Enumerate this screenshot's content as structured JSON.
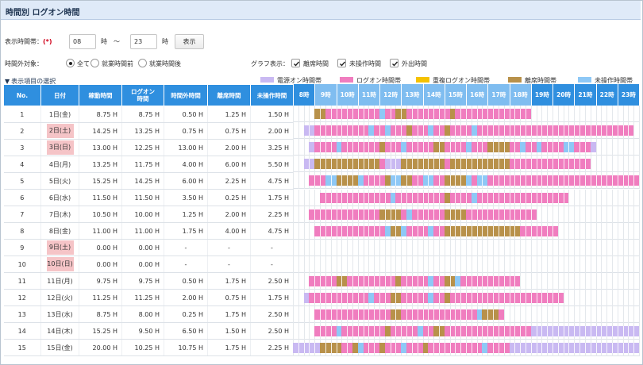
{
  "page": {
    "title": "時間別 ログオン時間"
  },
  "filter": {
    "range_label": "表示時間帯：",
    "required_mark": "(*)",
    "from_value": "08",
    "from_unit": "時",
    "tilde": "～",
    "to_value": "23",
    "to_unit": "時",
    "show_button": "表示"
  },
  "outside": {
    "label": "時間外対象：",
    "options": [
      {
        "label": "全て",
        "selected": true
      },
      {
        "label": "就業時間前",
        "selected": false
      },
      {
        "label": "就業時間後",
        "selected": false
      }
    ]
  },
  "graph": {
    "label": "グラフ表示：",
    "options": [
      {
        "label": "離席時間",
        "checked": true
      },
      {
        "label": "未操作時間",
        "checked": true
      },
      {
        "label": "外出時間",
        "checked": true
      }
    ]
  },
  "select_items_link": "表示項目の選択",
  "colors": {
    "power": "#c9b9f2",
    "logon": "#f07dbf",
    "dup": "#f5c200",
    "away": "#b8914a",
    "idle": "#8ec8f6",
    "header": "#2f8fdf",
    "header_band": "#7fbdf0",
    "holiday": "#f5c4c7"
  },
  "legend": [
    {
      "key": "power",
      "label": "電源オン時間帯"
    },
    {
      "key": "logon",
      "label": "ログオン時間帯"
    },
    {
      "key": "dup",
      "label": "重複ログオン時間帯"
    },
    {
      "key": "away",
      "label": "離席時間帯"
    },
    {
      "key": "idle",
      "label": "未操作時間帯"
    }
  ],
  "columns": [
    "No.",
    "日付",
    "稼動時間",
    "ログオン\n時間",
    "時間外時間",
    "離席時間",
    "未操作時間"
  ],
  "hours": [
    "8時",
    "9時",
    "10時",
    "11時",
    "12時",
    "13時",
    "14時",
    "15時",
    "16時",
    "17時",
    "18時",
    "19時",
    "20時",
    "21時",
    "22時",
    "23時"
  ],
  "rows": [
    {
      "no": "1",
      "date": "1日(金)",
      "holiday": false,
      "work": "8.75 H",
      "logon": "8.75 H",
      "outside": "0.50 H",
      "away": "1.25 H",
      "idle": "1.50 H",
      "segments": [
        [
          "away",
          9.0,
          9.5
        ],
        [
          "logon",
          9.5,
          12.0
        ],
        [
          "idle",
          12.0,
          12.25
        ],
        [
          "logon",
          12.25,
          12.75
        ],
        [
          "away",
          12.75,
          13.25
        ],
        [
          "logon",
          13.25,
          15.25
        ],
        [
          "away",
          15.25,
          15.5
        ],
        [
          "logon",
          15.5,
          19.0
        ]
      ]
    },
    {
      "no": "2",
      "date": "2日(土)",
      "holiday": true,
      "work": "14.25 H",
      "logon": "13.25 H",
      "outside": "0.75 H",
      "away": "0.75 H",
      "idle": "2.00 H",
      "segments": [
        [
          "power",
          8.5,
          9.0
        ],
        [
          "logon",
          9.0,
          11.5
        ],
        [
          "idle",
          11.5,
          11.75
        ],
        [
          "logon",
          11.75,
          12.25
        ],
        [
          "idle",
          12.25,
          12.5
        ],
        [
          "logon",
          12.5,
          13.25
        ],
        [
          "away",
          13.25,
          13.5
        ],
        [
          "logon",
          13.5,
          14.25
        ],
        [
          "idle",
          14.25,
          14.5
        ],
        [
          "logon",
          14.5,
          15.0
        ],
        [
          "away",
          15.0,
          15.25
        ],
        [
          "logon",
          15.25,
          16.25
        ],
        [
          "idle",
          16.25,
          16.5
        ],
        [
          "logon",
          16.5,
          23.75
        ]
      ]
    },
    {
      "no": "3",
      "date": "3日(日)",
      "holiday": true,
      "work": "13.00 H",
      "logon": "12.25 H",
      "outside": "13.00 H",
      "away": "2.00 H",
      "idle": "3.25 H",
      "segments": [
        [
          "power",
          8.75,
          9.0
        ],
        [
          "logon",
          9.0,
          10.0
        ],
        [
          "idle",
          10.0,
          10.25
        ],
        [
          "logon",
          10.25,
          12.0
        ],
        [
          "away",
          12.0,
          12.25
        ],
        [
          "logon",
          12.25,
          13.0
        ],
        [
          "idle",
          13.0,
          13.25
        ],
        [
          "logon",
          13.25,
          14.5
        ],
        [
          "away",
          14.5,
          15.0
        ],
        [
          "logon",
          15.0,
          16.0
        ],
        [
          "idle",
          16.0,
          16.25
        ],
        [
          "logon",
          16.25,
          17.0
        ],
        [
          "away",
          17.0,
          18.0
        ],
        [
          "logon",
          18.0,
          18.5
        ],
        [
          "idle",
          18.5,
          18.75
        ],
        [
          "logon",
          18.75,
          19.25
        ],
        [
          "idle",
          19.25,
          19.5
        ],
        [
          "logon",
          19.5,
          20.5
        ],
        [
          "idle",
          20.5,
          21.0
        ],
        [
          "logon",
          21.0,
          21.75
        ],
        [
          "power",
          21.75,
          22.0
        ]
      ]
    },
    {
      "no": "4",
      "date": "4日(月)",
      "holiday": false,
      "work": "13.25 H",
      "logon": "11.75 H",
      "outside": "4.00 H",
      "away": "6.00 H",
      "idle": "5.50 H",
      "segments": [
        [
          "power",
          8.5,
          9.0
        ],
        [
          "away",
          9.0,
          12.0
        ],
        [
          "logon",
          12.0,
          12.25
        ],
        [
          "power",
          12.25,
          13.0
        ],
        [
          "away",
          13.0,
          15.0
        ],
        [
          "logon",
          15.0,
          15.25
        ],
        [
          "away",
          15.25,
          18.0
        ],
        [
          "logon",
          18.0,
          21.75
        ]
      ]
    },
    {
      "no": "5",
      "date": "5日(火)",
      "holiday": false,
      "work": "15.25 H",
      "logon": "14.25 H",
      "outside": "6.00 H",
      "away": "2.25 H",
      "idle": "4.75 H",
      "segments": [
        [
          "logon",
          8.75,
          9.5
        ],
        [
          "idle",
          9.5,
          10.0
        ],
        [
          "away",
          10.0,
          11.0
        ],
        [
          "idle",
          11.0,
          11.25
        ],
        [
          "logon",
          11.25,
          12.25
        ],
        [
          "away",
          12.25,
          12.5
        ],
        [
          "idle",
          12.5,
          13.0
        ],
        [
          "away",
          13.0,
          13.5
        ],
        [
          "logon",
          13.5,
          14.0
        ],
        [
          "idle",
          14.0,
          14.5
        ],
        [
          "logon",
          14.5,
          15.0
        ],
        [
          "away",
          15.0,
          16.0
        ],
        [
          "idle",
          16.0,
          16.25
        ],
        [
          "logon",
          16.25,
          16.5
        ],
        [
          "idle",
          16.5,
          17.0
        ],
        [
          "logon",
          17.0,
          24.0
        ]
      ]
    },
    {
      "no": "6",
      "date": "6日(水)",
      "holiday": false,
      "work": "11.50 H",
      "logon": "11.50 H",
      "outside": "3.50 H",
      "away": "0.25 H",
      "idle": "1.75 H",
      "segments": [
        [
          "logon",
          9.25,
          12.5
        ],
        [
          "idle",
          12.5,
          12.75
        ],
        [
          "logon",
          12.75,
          15.0
        ],
        [
          "away",
          15.0,
          15.25
        ],
        [
          "logon",
          15.25,
          16.25
        ],
        [
          "idle",
          16.25,
          16.5
        ],
        [
          "logon",
          16.5,
          20.75
        ]
      ]
    },
    {
      "no": "7",
      "date": "7日(木)",
      "holiday": false,
      "work": "10.50 H",
      "logon": "10.00 H",
      "outside": "1.25 H",
      "away": "2.00 H",
      "idle": "2.25 H",
      "segments": [
        [
          "logon",
          8.75,
          12.0
        ],
        [
          "away",
          12.0,
          13.0
        ],
        [
          "logon",
          13.0,
          13.25
        ],
        [
          "idle",
          13.25,
          13.5
        ],
        [
          "logon",
          13.5,
          15.0
        ],
        [
          "away",
          15.0,
          16.0
        ],
        [
          "logon",
          16.0,
          19.25
        ]
      ]
    },
    {
      "no": "8",
      "date": "8日(金)",
      "holiday": false,
      "work": "11.00 H",
      "logon": "11.00 H",
      "outside": "1.75 H",
      "away": "4.00 H",
      "idle": "4.75 H",
      "segments": [
        [
          "logon",
          9.0,
          12.25
        ],
        [
          "idle",
          12.25,
          12.5
        ],
        [
          "away",
          12.5,
          13.0
        ],
        [
          "idle",
          13.0,
          13.25
        ],
        [
          "logon",
          13.25,
          14.25
        ],
        [
          "idle",
          14.25,
          14.5
        ],
        [
          "logon",
          14.5,
          15.0
        ],
        [
          "away",
          15.0,
          18.5
        ],
        [
          "logon",
          18.5,
          20.25
        ]
      ]
    },
    {
      "no": "9",
      "date": "9日(土)",
      "holiday": true,
      "work": "0.00 H",
      "logon": "0.00 H",
      "outside": "-",
      "away": "-",
      "idle": "-",
      "segments": []
    },
    {
      "no": "10",
      "date": "10日(日)",
      "holiday": true,
      "work": "0.00 H",
      "logon": "0.00 H",
      "outside": "-",
      "away": "-",
      "idle": "-",
      "segments": []
    },
    {
      "no": "11",
      "date": "11日(月)",
      "holiday": false,
      "work": "9.75 H",
      "logon": "9.75 H",
      "outside": "0.50 H",
      "away": "1.75 H",
      "idle": "2.50 H",
      "segments": [
        [
          "logon",
          8.75,
          10.0
        ],
        [
          "away",
          10.0,
          10.5
        ],
        [
          "logon",
          10.5,
          12.75
        ],
        [
          "away",
          12.75,
          13.0
        ],
        [
          "logon",
          13.0,
          14.25
        ],
        [
          "idle",
          14.25,
          14.5
        ],
        [
          "logon",
          14.5,
          15.0
        ],
        [
          "away",
          15.0,
          15.5
        ],
        [
          "idle",
          15.5,
          15.75
        ],
        [
          "logon",
          15.75,
          18.5
        ]
      ]
    },
    {
      "no": "12",
      "date": "12日(火)",
      "holiday": false,
      "work": "11.25 H",
      "logon": "11.25 H",
      "outside": "2.00 H",
      "away": "0.75 H",
      "idle": "1.75 H",
      "segments": [
        [
          "power",
          8.5,
          8.75
        ],
        [
          "logon",
          8.75,
          11.5
        ],
        [
          "idle",
          11.5,
          11.75
        ],
        [
          "logon",
          11.75,
          12.5
        ],
        [
          "away",
          12.5,
          13.0
        ],
        [
          "logon",
          13.0,
          14.25
        ],
        [
          "idle",
          14.25,
          14.5
        ],
        [
          "logon",
          14.5,
          15.0
        ],
        [
          "away",
          15.0,
          15.25
        ],
        [
          "logon",
          15.25,
          20.5
        ]
      ]
    },
    {
      "no": "13",
      "date": "13日(水)",
      "holiday": false,
      "work": "8.75 H",
      "logon": "8.00 H",
      "outside": "0.25 H",
      "away": "1.75 H",
      "idle": "2.50 H",
      "segments": [
        [
          "logon",
          9.0,
          12.5
        ],
        [
          "away",
          12.5,
          13.0
        ],
        [
          "logon",
          13.0,
          16.5
        ],
        [
          "idle",
          16.5,
          16.75
        ],
        [
          "away",
          16.75,
          17.5
        ],
        [
          "logon",
          17.5,
          17.75
        ]
      ]
    },
    {
      "no": "14",
      "date": "14日(木)",
      "holiday": false,
      "work": "15.25 H",
      "logon": "9.50 H",
      "outside": "6.50 H",
      "away": "1.50 H",
      "idle": "2.50 H",
      "segments": [
        [
          "logon",
          9.0,
          10.0
        ],
        [
          "idle",
          10.0,
          10.25
        ],
        [
          "logon",
          10.25,
          12.25
        ],
        [
          "away",
          12.25,
          12.5
        ],
        [
          "logon",
          12.5,
          13.75
        ],
        [
          "idle",
          13.75,
          14.0
        ],
        [
          "logon",
          14.0,
          14.5
        ],
        [
          "away",
          14.5,
          15.0
        ],
        [
          "logon",
          15.0,
          19.0
        ],
        [
          "power",
          19.0,
          24.0
        ]
      ]
    },
    {
      "no": "15",
      "date": "15日(金)",
      "holiday": false,
      "work": "20.00 H",
      "logon": "10.25 H",
      "outside": "10.75 H",
      "away": "1.75 H",
      "idle": "2.25 H",
      "segments": [
        [
          "power",
          8.0,
          9.25
        ],
        [
          "away",
          9.25,
          10.25
        ],
        [
          "logon",
          10.25,
          10.75
        ],
        [
          "away",
          10.75,
          11.0
        ],
        [
          "idle",
          11.0,
          11.25
        ],
        [
          "logon",
          11.25,
          12.0
        ],
        [
          "away",
          12.0,
          12.25
        ],
        [
          "logon",
          12.25,
          13.0
        ],
        [
          "idle",
          13.0,
          13.25
        ],
        [
          "logon",
          13.25,
          14.0
        ],
        [
          "away",
          14.0,
          14.25
        ],
        [
          "logon",
          14.25,
          16.75
        ],
        [
          "idle",
          16.75,
          17.0
        ],
        [
          "logon",
          17.0,
          18.0
        ],
        [
          "power",
          18.0,
          24.0
        ]
      ]
    }
  ]
}
